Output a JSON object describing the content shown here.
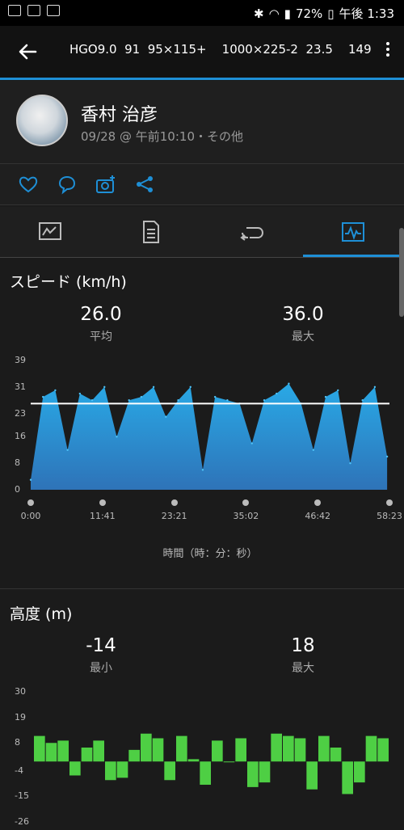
{
  "status": {
    "battery": "72%",
    "time": "午後 1:33"
  },
  "header": {
    "title": "HGO9.0  91  95×115+    1000×225-2  23.5    149"
  },
  "profile": {
    "name": "香村 治彦",
    "meta": "09/28 @ 午前10:10・その他"
  },
  "actions": {
    "icons": [
      "heart-icon",
      "comment-icon",
      "camera-add-icon",
      "share-icon"
    ]
  },
  "tabs": {
    "items": [
      "summary-tab-icon",
      "details-tab-icon",
      "laps-tab-icon",
      "charts-tab-icon"
    ],
    "active_index": 3
  },
  "speed": {
    "title": "スピード (km/h)",
    "avg_value": "26.0",
    "avg_label": "平均",
    "max_value": "36.0",
    "max_label": "最大",
    "x_caption": "時間（時：分：秒）"
  },
  "elevation": {
    "title": "高度 (m)",
    "min_value": "-14",
    "min_label": "最小",
    "max_value": "18",
    "max_label": "最大"
  },
  "colors": {
    "accent": "#1e8fd6",
    "speed_fill_top": "#29a9e6",
    "speed_fill_bottom": "#2e73b8",
    "elevation_fill": "#4ecf44"
  },
  "chart_data": [
    {
      "type": "area",
      "title": "スピード (km/h)",
      "xlabel": "時間（時：分：秒）",
      "ylabel": "",
      "x_ticks": [
        "0:00",
        "11:41",
        "23:21",
        "35:02",
        "46:42",
        "58:23"
      ],
      "y_ticks": [
        0,
        8,
        16,
        23,
        31,
        39
      ],
      "ylim": [
        0,
        39
      ],
      "reference_line": 26.0,
      "x": [
        0,
        2,
        4,
        6,
        8,
        10,
        12,
        14,
        16,
        18,
        20,
        22,
        24,
        26,
        28,
        30,
        32,
        34,
        36,
        38,
        40,
        42,
        44,
        46,
        48,
        50,
        52,
        54,
        56,
        58
      ],
      "values": [
        3,
        28,
        30,
        12,
        29,
        27,
        31,
        16,
        27,
        28,
        31,
        22,
        27,
        31,
        6,
        28,
        27,
        26,
        14,
        27,
        29,
        32,
        26,
        12,
        28,
        30,
        8,
        27,
        31,
        10
      ]
    },
    {
      "type": "bar",
      "title": "高度 (m)",
      "y_ticks": [
        30,
        19,
        8,
        -4,
        -15,
        -26
      ],
      "ylim": [
        -26,
        30
      ],
      "x": [
        0,
        2,
        4,
        6,
        8,
        10,
        12,
        14,
        16,
        18,
        20,
        22,
        24,
        26,
        28,
        30,
        32,
        34,
        36,
        38,
        40,
        42,
        44,
        46,
        48,
        50,
        52,
        54,
        56,
        58
      ],
      "values": [
        11,
        8,
        9,
        -6,
        6,
        9,
        -8,
        -7,
        5,
        12,
        10,
        -8,
        11,
        1,
        -10,
        9,
        0,
        10,
        -11,
        -9,
        12,
        11,
        10,
        -12,
        11,
        6,
        -14,
        -9,
        11,
        10
      ]
    }
  ]
}
